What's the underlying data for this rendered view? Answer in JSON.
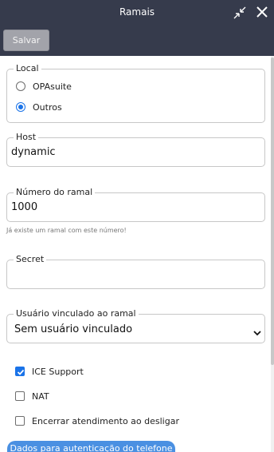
{
  "window": {
    "title": "Ramais",
    "shrink_icon": "shrink-arrows-icon",
    "close_icon": "close-icon"
  },
  "toolbar": {
    "save_label": "Salvar"
  },
  "form": {
    "local": {
      "legend": "Local",
      "options": [
        "OPAsuite",
        "Outros"
      ],
      "selected": "Outros"
    },
    "host": {
      "label": "Host",
      "value": "dynamic"
    },
    "extension": {
      "label": "Número do ramal",
      "value": "1000",
      "hint": "Já existe um ramal com este número!"
    },
    "secret": {
      "label": "Secret",
      "value": ""
    },
    "linked_user": {
      "label": "Usuário vinculado ao ramal",
      "value": "Sem usuário vinculado"
    },
    "checkboxes": [
      {
        "label": "ICE Support",
        "checked": true
      },
      {
        "label": "NAT",
        "checked": false
      },
      {
        "label": "Encerrar atendimento ao desligar",
        "checked": false
      }
    ],
    "section_tab": "Dados para autenticação do telefone"
  },
  "colors": {
    "header_bg": "#363b4c",
    "accent": "#1a73e8",
    "section_tab": "#4a90e2",
    "save_button": "#a2a3aa"
  }
}
